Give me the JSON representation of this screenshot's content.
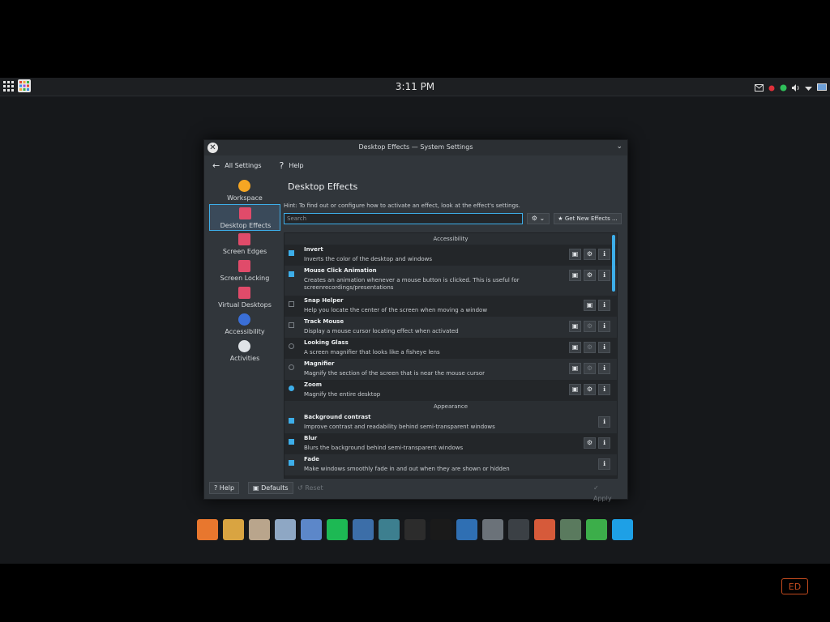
{
  "topbar": {
    "clock": "3:11 PM",
    "tray_icons": [
      "mail-icon",
      "record-icon",
      "network-icon",
      "volume-icon",
      "dropdown-icon",
      "screen-icon"
    ]
  },
  "window": {
    "title": "Desktop Effects — System Settings",
    "nav": {
      "back_label": "All Settings",
      "help_label": "Help"
    },
    "sidebar": [
      {
        "label": "Workspace",
        "icon": "workspace-icon",
        "color": "#f6a623"
      },
      {
        "label": "Desktop Effects",
        "icon": "desktop-effects-icon",
        "color": "#e04b6a",
        "active": true
      },
      {
        "label": "Screen Edges",
        "icon": "screen-edges-icon",
        "color": "#e04b6a"
      },
      {
        "label": "Screen Locking",
        "icon": "screen-locking-icon",
        "color": "#e04b6a"
      },
      {
        "label": "Virtual Desktops",
        "icon": "virtual-desktops-icon",
        "color": "#e04b6a"
      },
      {
        "label": "Accessibility",
        "icon": "accessibility-icon",
        "color": "#3a6fd8"
      },
      {
        "label": "Activities",
        "icon": "activities-icon",
        "color": "#dfe3e7"
      }
    ],
    "content": {
      "title": "Desktop Effects",
      "hint": "Hint: To find out or configure how to activate an effect, look at the effect's settings.",
      "search_placeholder": "Search",
      "get_new_label": "Get New Effects ..."
    },
    "categories": [
      {
        "name": "Accessibility",
        "effects": [
          {
            "name": "Invert",
            "desc": "Inverts the color of the desktop and windows",
            "control": "check",
            "on": true,
            "buttons": [
              "video",
              "config",
              "info"
            ]
          },
          {
            "name": "Mouse Click Animation",
            "desc": "Creates an animation whenever a mouse button is clicked. This is useful for screenrecordings/presentations",
            "control": "check",
            "on": true,
            "buttons": [
              "video",
              "config",
              "info"
            ],
            "tall": true
          },
          {
            "name": "Snap Helper",
            "desc": "Help you locate the center of the screen when moving a window",
            "control": "check",
            "on": false,
            "buttons": [
              "video",
              "info"
            ]
          },
          {
            "name": "Track Mouse",
            "desc": "Display a mouse cursor locating effect when activated",
            "control": "check",
            "on": false,
            "buttons": [
              "video",
              "config-dim",
              "info"
            ]
          },
          {
            "name": "Looking Glass",
            "desc": "A screen magnifier that looks like a fisheye lens",
            "control": "radio",
            "on": false,
            "buttons": [
              "video",
              "config-dim",
              "info"
            ]
          },
          {
            "name": "Magnifier",
            "desc": "Magnify the section of the screen that is near the mouse cursor",
            "control": "radio",
            "on": false,
            "buttons": [
              "video",
              "config-dim",
              "info"
            ]
          },
          {
            "name": "Zoom",
            "desc": "Magnify the entire desktop",
            "control": "radio",
            "on": true,
            "buttons": [
              "video",
              "config",
              "info"
            ]
          }
        ]
      },
      {
        "name": "Appearance",
        "effects": [
          {
            "name": "Background contrast",
            "desc": "Improve contrast and readability behind semi-transparent windows",
            "control": "check",
            "on": true,
            "buttons": [
              "info"
            ]
          },
          {
            "name": "Blur",
            "desc": "Blurs the background behind semi-transparent windows",
            "control": "check",
            "on": true,
            "buttons": [
              "config",
              "info"
            ]
          },
          {
            "name": "Fade",
            "desc": "Make windows smoothly fade in and out when they are shown or hidden",
            "control": "check",
            "on": true,
            "buttons": [
              "info"
            ]
          }
        ]
      }
    ],
    "footer": {
      "help": "Help",
      "defaults": "Defaults",
      "reset": "Reset",
      "apply": "Apply"
    }
  },
  "dock": [
    {
      "icon": "firefox-icon",
      "color": "#e8772e"
    },
    {
      "icon": "chrome-icon",
      "color": "#d9a441"
    },
    {
      "icon": "file-manager-icon",
      "color": "#b9a58c"
    },
    {
      "icon": "files-icon",
      "color": "#8ea7c4"
    },
    {
      "icon": "settings-icon",
      "color": "#5c87c9"
    },
    {
      "icon": "spotify-icon",
      "color": "#1db954"
    },
    {
      "icon": "video-editor-icon",
      "color": "#3c6ea8"
    },
    {
      "icon": "music-icon",
      "color": "#3d7f8f"
    },
    {
      "icon": "obs-icon",
      "color": "#2c2c2c"
    },
    {
      "icon": "linux-icon",
      "color": "#1a1a1a"
    },
    {
      "icon": "simplenote-icon",
      "color": "#2f6fb3"
    },
    {
      "icon": "calculator-icon",
      "color": "#6b7279"
    },
    {
      "icon": "terminal-icon",
      "color": "#3b4045"
    },
    {
      "icon": "system-settings-icon",
      "color": "#d65a3a"
    },
    {
      "icon": "system-monitor-icon",
      "color": "#5a7a5e"
    },
    {
      "icon": "update-icon",
      "color": "#3cae4a"
    },
    {
      "icon": "windows-icon",
      "color": "#1ea0e6"
    }
  ],
  "watermark": "ED"
}
